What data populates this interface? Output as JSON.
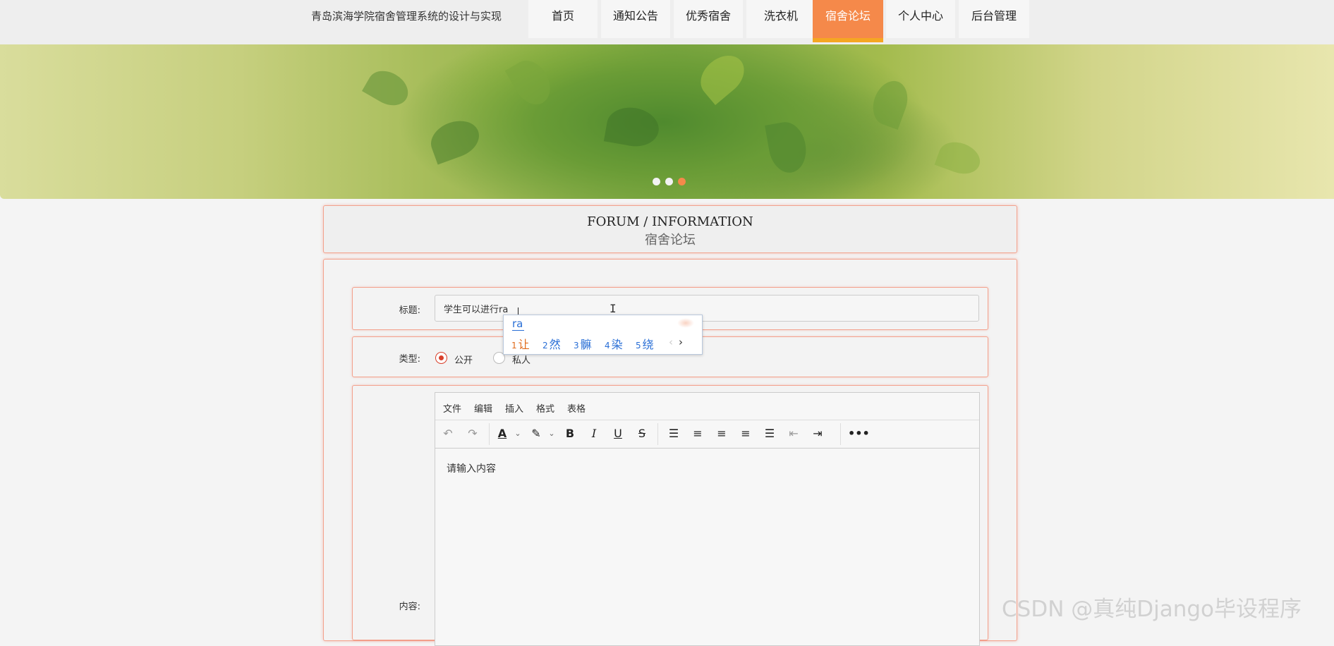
{
  "site": {
    "title": "青岛滨海学院宿舍管理系统的设计与实现"
  },
  "nav": {
    "items": [
      {
        "label": "首页"
      },
      {
        "label": "通知公告"
      },
      {
        "label": "优秀宿舍"
      },
      {
        "label": "洗衣机"
      },
      {
        "label": "宿舍论坛",
        "active": true
      },
      {
        "label": "个人中心"
      },
      {
        "label": "后台管理"
      }
    ],
    "active_color": "#f5894a",
    "active_underline_color": "#f5a623"
  },
  "banner": {
    "slide_count": 3,
    "active_slide": 3
  },
  "forum": {
    "title_en": "FORUM / INFORMATION",
    "title_cn": "宿舍论坛"
  },
  "form": {
    "title_label": "标题:",
    "title_value": "学生可以进行ra",
    "type_label": "类型:",
    "type_options": [
      {
        "label": "公开",
        "checked": true
      },
      {
        "label": "私人",
        "checked": false
      }
    ],
    "content_label": "内容:",
    "content_placeholder": "请输入内容"
  },
  "ime": {
    "composition": "ra",
    "candidates": [
      {
        "num": "1",
        "text": "让"
      },
      {
        "num": "2",
        "text": "然"
      },
      {
        "num": "3",
        "text": "髍"
      },
      {
        "num": "4",
        "text": "染"
      },
      {
        "num": "5",
        "text": "绕"
      }
    ],
    "prev": "‹",
    "next": "›"
  },
  "editor": {
    "menus": [
      "文件",
      "编辑",
      "插入",
      "格式",
      "表格"
    ],
    "toolbar_icons": [
      "undo-icon",
      "redo-icon",
      "text-color-icon",
      "highlight-color-icon",
      "bold-icon",
      "italic-icon",
      "underline-icon",
      "strikethrough-icon",
      "line-height-icon",
      "align-left-icon",
      "align-center-icon",
      "align-right-icon",
      "align-justify-icon",
      "outdent-icon",
      "indent-icon",
      "more-icon"
    ]
  },
  "watermark": "CSDN @真纯Django毕设程序"
}
